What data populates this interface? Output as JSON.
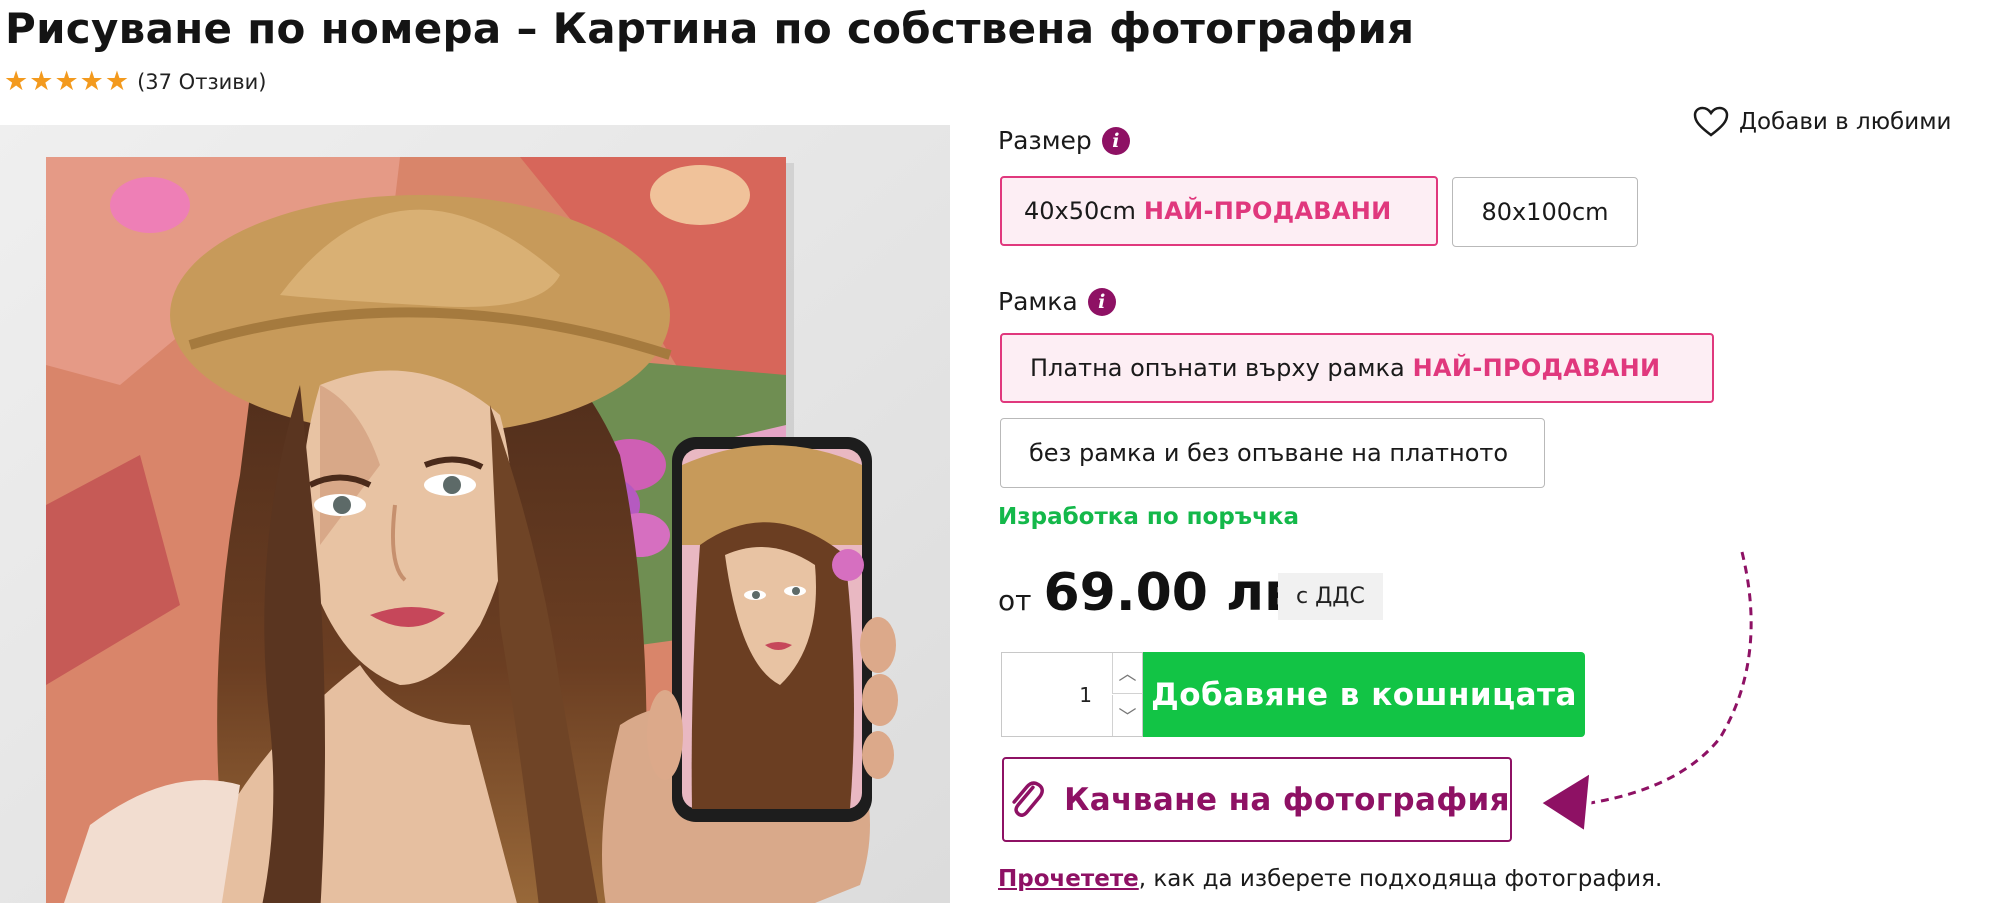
{
  "product": {
    "title": "Рисуване по номера – Картина по собствена фотография",
    "rating": {
      "stars": 5,
      "reviews_text": "(37 Отзиви)"
    }
  },
  "wishlist": {
    "label": "Добави в любими",
    "icon": "heart-icon"
  },
  "size": {
    "label": "Размер",
    "options": [
      {
        "label": "40x50cm",
        "badge": "НАЙ-ПРОДАВАНИ",
        "selected": true
      },
      {
        "label": "80x100cm",
        "selected": false
      }
    ]
  },
  "frame": {
    "label": "Рамка",
    "options": [
      {
        "label": "Платна опънати върху рамка",
        "badge": "НАЙ-ПРОДАВАНИ",
        "selected": true
      },
      {
        "label": "без рамка и без опъване на платното",
        "selected": false
      }
    ]
  },
  "availability": "Изработка по поръчка",
  "price": {
    "prefix": "от",
    "value": "69.00 лв",
    "vat": "с ДДС"
  },
  "cart": {
    "quantity": "1",
    "add_label": "Добавяне в кошницата"
  },
  "upload": {
    "label": "Качване на фотография",
    "icon": "paperclip-icon"
  },
  "help": {
    "link": "Прочетете",
    "rest": ", как да изберете подходяща фотография."
  },
  "colors": {
    "accent": "#8e1164",
    "badge": "#e0387d",
    "cta": "#12c445",
    "availability": "#14b84a",
    "star": "#f39a1e"
  }
}
